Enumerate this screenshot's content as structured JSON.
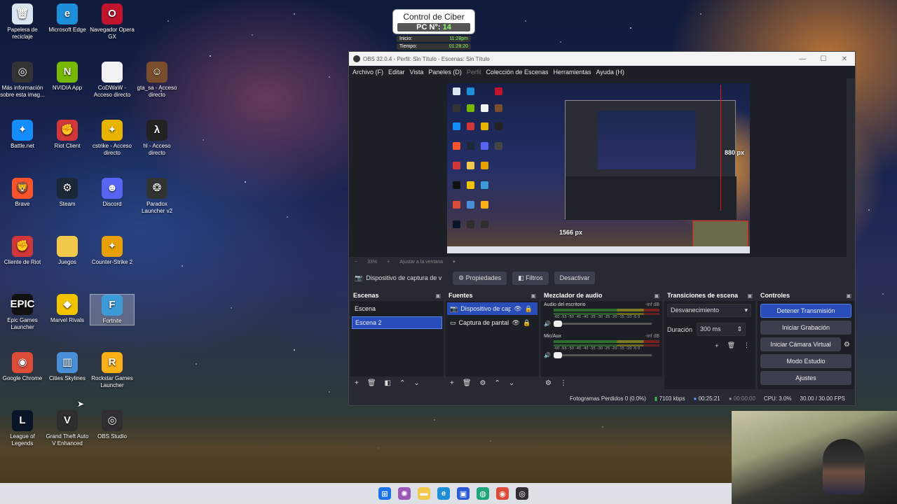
{
  "desktop": {
    "icons": [
      {
        "label": "Papelera de reciclaje",
        "icon": "recycle-bin-icon",
        "color": "#d9e6f2",
        "glyph": "🗑"
      },
      {
        "label": "Microsoft Edge",
        "icon": "edge-icon",
        "color": "#1c8fd8",
        "glyph": "e"
      },
      {
        "label": "Navegador Opera GX",
        "icon": "opera-gx-icon",
        "color": "#c0142c",
        "glyph": "O"
      },
      {
        "label": "Más información sobre esta imag...",
        "icon": "info-spotlight-icon",
        "color": "#333333",
        "glyph": "◎"
      },
      {
        "label": "NVIDIA App",
        "icon": "nvidia-icon",
        "color": "#76b900",
        "glyph": "N"
      },
      {
        "label": "CoDWaW - Acceso directo",
        "icon": "file-icon",
        "color": "#f2f2f2",
        "glyph": " "
      },
      {
        "label": "gta_sa - Acceso directo",
        "icon": "gta-sa-icon",
        "color": "#7a4d2d",
        "glyph": "☺"
      },
      {
        "label": "Battle.net",
        "icon": "battlenet-icon",
        "color": "#148eff",
        "glyph": "✦"
      },
      {
        "label": "Riot Client",
        "icon": "riot-client-icon",
        "color": "#d13639",
        "glyph": "✊"
      },
      {
        "label": "cstrike - Acceso directo",
        "icon": "counter-strike-icon",
        "color": "#e8b400",
        "glyph": "✦"
      },
      {
        "label": "hl - Acceso directo",
        "icon": "half-life-icon",
        "color": "#222222",
        "glyph": "λ"
      },
      {
        "label": "Brave",
        "icon": "brave-icon",
        "color": "#fb542b",
        "glyph": "🦁"
      },
      {
        "label": "Steam",
        "icon": "steam-icon",
        "color": "#1b2838",
        "glyph": "⚙"
      },
      {
        "label": "Discord",
        "icon": "discord-icon",
        "color": "#5865f2",
        "glyph": "☻"
      },
      {
        "label": "Paradox Launcher v2",
        "icon": "paradox-icon",
        "color": "#333333",
        "glyph": "❂"
      },
      {
        "label": "Cliente de Riot",
        "icon": "riot-client-icon",
        "color": "#d13639",
        "glyph": "✊"
      },
      {
        "label": "Juegos",
        "icon": "folder-icon",
        "color": "#f2c94c",
        "glyph": " "
      },
      {
        "label": "Counter-Strike 2",
        "icon": "cs2-icon",
        "color": "#e8a000",
        "glyph": "✦"
      },
      {
        "label": "Epic Games Launcher",
        "icon": "epic-games-icon",
        "color": "#111111",
        "glyph": "EPIC"
      },
      {
        "label": "Marvel Rivals",
        "icon": "marvel-rivals-icon",
        "color": "#f2c400",
        "glyph": "◆"
      },
      {
        "label": "Fortnite",
        "icon": "fortnite-icon",
        "color": "#3c9bd6",
        "glyph": "F"
      },
      {
        "label": "Google Chrome",
        "icon": "chrome-icon",
        "color": "#dd4b39",
        "glyph": "◉"
      },
      {
        "label": "Cities Skylines",
        "icon": "cities-skylines-icon",
        "color": "#4a90d9",
        "glyph": "▥"
      },
      {
        "label": "Rockstar Games Launcher",
        "icon": "rockstar-icon",
        "color": "#fcaf17",
        "glyph": "R"
      },
      {
        "label": "League of Legends",
        "icon": "lol-icon",
        "color": "#0a1428",
        "glyph": "L"
      },
      {
        "label": "Grand Theft Auto V Enhanced",
        "icon": "gtav-icon",
        "color": "#2e2e2e",
        "glyph": "V"
      },
      {
        "label": "OBS Studio",
        "icon": "obs-icon",
        "color": "#302e31",
        "glyph": "◎"
      }
    ]
  },
  "ciber_widget": {
    "title": "Control de Ciber",
    "pc_label": "PC N°:",
    "pc_number": "14",
    "inicio_label": "Inicio:",
    "inicio_value": "11:28pm",
    "tiempo_label": "Tiempo:",
    "tiempo_value": "01:28:20"
  },
  "obs": {
    "title": "OBS 32.0.4 - Perfil: Sin Título - Escenas: Sin Título",
    "window_controls": {
      "minimize": "—",
      "maximize": "☐",
      "close": "✕"
    },
    "menu": [
      "Archivo (F)",
      "Editar",
      "Vista",
      "Paneles (D)",
      "Perfil",
      "Colección de Escenas",
      "Herramientas",
      "Ayuda (H)"
    ],
    "preview": {
      "width_label": "1566 px",
      "height_label": "880 px",
      "zoom": "33%",
      "fit_label": "Ajustar a la ventana"
    },
    "source_toolbar": {
      "selected_source": "Dispositivo de captura de v",
      "properties": "Propiedades",
      "filters": "Filtros",
      "deactivate": "Desactivar"
    },
    "scenes": {
      "title": "Escenas",
      "items": [
        "Escena",
        "Escena 2"
      ],
      "selected_index": 1
    },
    "sources": {
      "title": "Fuentes",
      "items": [
        "Dispositivo de cap",
        "Captura de pantal"
      ],
      "selected_index": 0
    },
    "mixer": {
      "title": "Mezclador de audio",
      "channels": [
        {
          "name": "Audio del escritorio",
          "db": "-inf dB"
        },
        {
          "name": "Mic/Aux",
          "db": "-inf dB"
        }
      ],
      "ticks": "-60 -55 -50 -45 -40 -35 -30 -25 -20 -15 -10 -5 0"
    },
    "transitions": {
      "title": "Transiciones de escena",
      "selected": "Desvanecimiento",
      "duration_label": "Duración",
      "duration_value": "300 ms"
    },
    "controls": {
      "title": "Controles",
      "stop_stream": "Detener Transmisión",
      "start_recording": "Iniciar Grabación",
      "start_virtual_cam": "Iniciar Cámara Virtual",
      "studio_mode": "Modo Estudio",
      "settings": "Ajustes"
    },
    "status": {
      "dropped_frames": "Fotogramas Perdidos 0 (0.0%)",
      "bitrate": "7103 kbps",
      "stream_time": "00:25:21",
      "record_time": "00:00:00",
      "cpu": "CPU: 3.0%",
      "fps": "30.00 / 30.00 FPS"
    },
    "colors": {
      "accent": "#284cb8",
      "panel": "#1d1f26",
      "chrome": "#272a33"
    }
  },
  "taskbar": {
    "items": [
      {
        "icon": "windows-start-icon",
        "color": "#1a73e8",
        "glyph": "⊞"
      },
      {
        "icon": "copilot-icon",
        "color": "#9b59b6",
        "glyph": "✺"
      },
      {
        "icon": "file-explorer-icon",
        "color": "#f2c94c",
        "glyph": "▬"
      },
      {
        "icon": "edge-icon",
        "color": "#1c8fd8",
        "glyph": "e"
      },
      {
        "icon": "store-icon",
        "color": "#2a5ad6",
        "glyph": "▣"
      },
      {
        "icon": "xbox-icon",
        "color": "#1fa67a",
        "glyph": "◍"
      },
      {
        "icon": "chrome-icon",
        "color": "#dd4b39",
        "glyph": "◉"
      },
      {
        "icon": "obs-icon",
        "color": "#302e31",
        "glyph": "◎"
      }
    ]
  }
}
